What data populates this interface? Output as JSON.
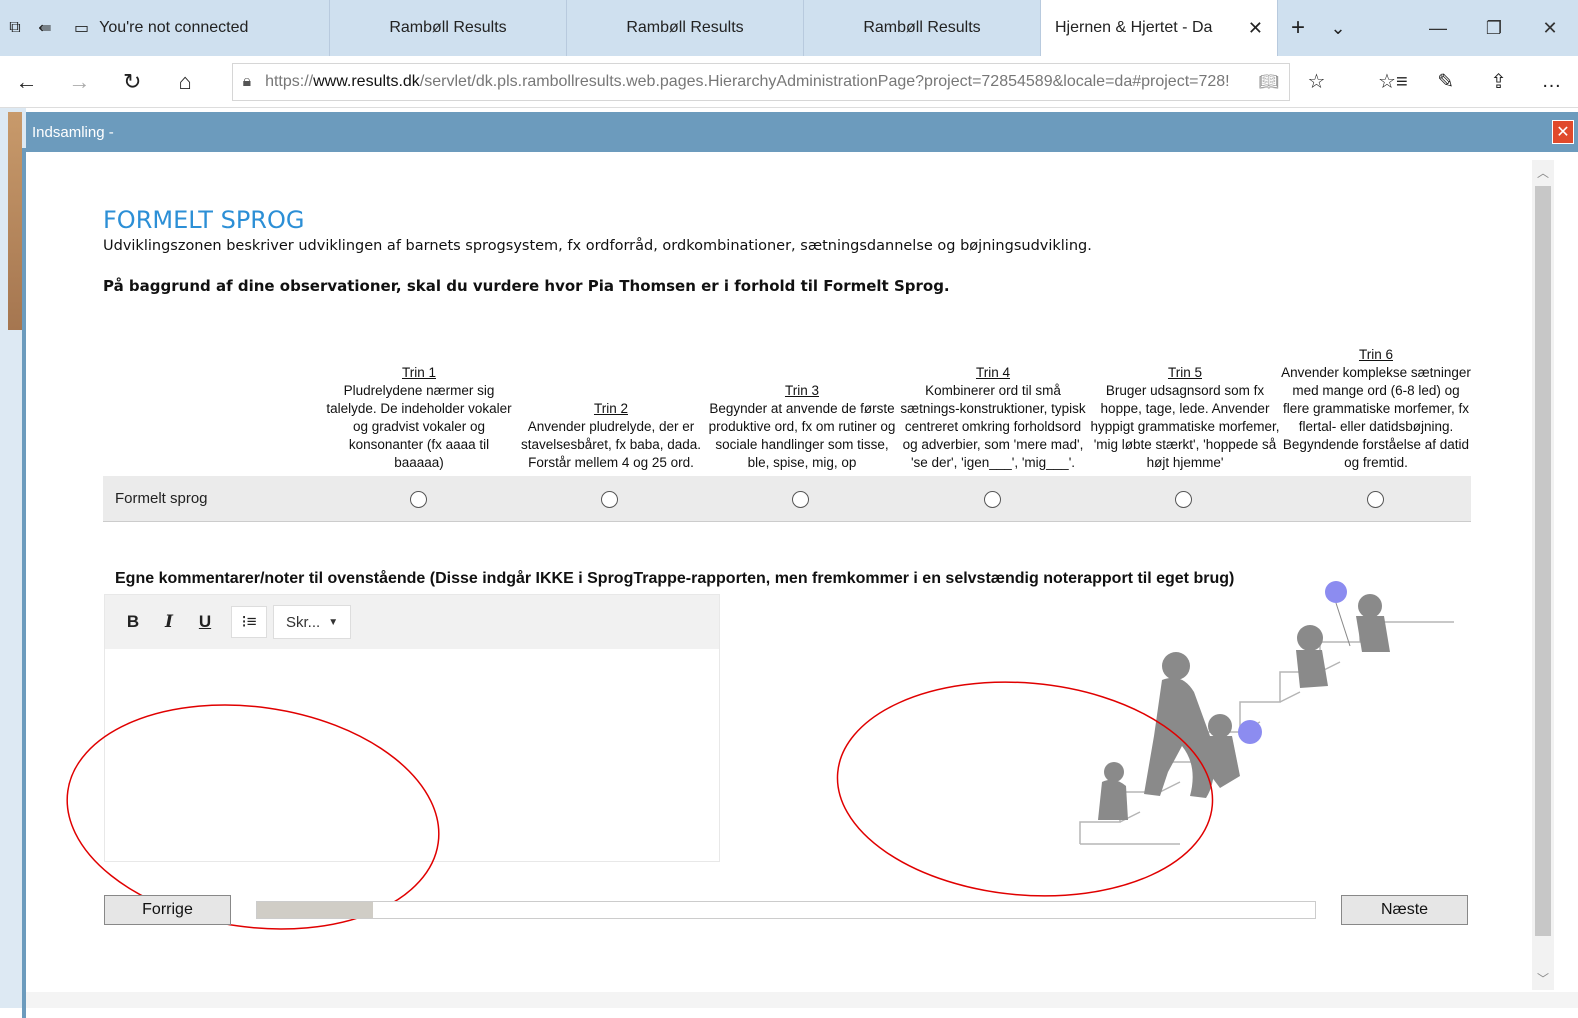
{
  "browser": {
    "tabs": [
      {
        "label": "You're not connected",
        "icon": "page-icon"
      },
      {
        "label": "Rambøll Results"
      },
      {
        "label": "Rambøll Results"
      },
      {
        "label": "Rambøll Results"
      },
      {
        "label": "Hjernen & Hjertet - Da",
        "active": true
      }
    ],
    "url_prefix": "https://",
    "url_domain": "www.results.dk",
    "url_path": "/servlet/dk.pls.rambollresults.web.pages.HierarchyAdministrationPage?project=72854589&locale=da#project=728!"
  },
  "dialog": {
    "title": "Indsamling -",
    "close_label": "✕"
  },
  "page": {
    "heading": "FORMELT SPROG",
    "description": "Udviklingszonen beskriver udviklingen af barnets sprogsystem, fx ordforråd, ordkombinationer, sætningsdannelse og bøjningsudvikling.",
    "question": "På baggrund af dine observationer, skal du vurdere hvor Pia Thomsen er i forhold til Formelt Sprog."
  },
  "rating": {
    "row_label": "Formelt sprog",
    "steps": [
      {
        "title": "Trin 1",
        "text": "Pludrelydene nærmer sig talelyde. De indeholder vokaler og gradvist vokaler og konsonanter (fx aaaa til baaaaa)"
      },
      {
        "title": "Trin 2",
        "text": "Anvender pludrelyde, der er stavelsesbåret, fx baba, dada. Forstår mellem 4 og 25 ord."
      },
      {
        "title": "Trin 3",
        "text": "Begynder at anvende de første produktive ord, fx om rutiner og sociale handlinger som tisse, ble, spise, mig, op"
      },
      {
        "title": "Trin 4",
        "text": "Kombinerer ord til små sætnings-konstruktioner, typisk centreret omkring forholdsord og adverbier, som 'mere mad', 'se der', 'igen___', 'mig___'."
      },
      {
        "title": "Trin 5",
        "text": "Bruger udsagnsord som fx hoppe, tage, lede. Anvender hyppigt grammatiske morfemer, 'mig løbte stærkt', 'hoppede så højt hjemme'"
      },
      {
        "title": "Trin 6",
        "text": "Anvender komplekse sætninger med mange ord (6-8 led) og flere grammatiske morfemer, fx flertal- eller datidsbøjning. Begyndende forståelse af datid og fremtid."
      }
    ]
  },
  "comments": {
    "label": "Egne kommentarer/noter til ovenstående (Disse indgår IKKE i SprogTrappe-rapporten, men fremkommer i en selvstændig noterapport til eget brug)",
    "toolbar": {
      "bold": "B",
      "italic": "I",
      "underline": "U",
      "font_select": "Skr..."
    }
  },
  "navigation": {
    "prev_label": "Forrige",
    "next_label": "Næste",
    "progress_fraction": 0.11
  },
  "colors": {
    "accent": "#2c8fd6",
    "dialog_header": "#6c9bbd",
    "annotation": "#e00000"
  }
}
